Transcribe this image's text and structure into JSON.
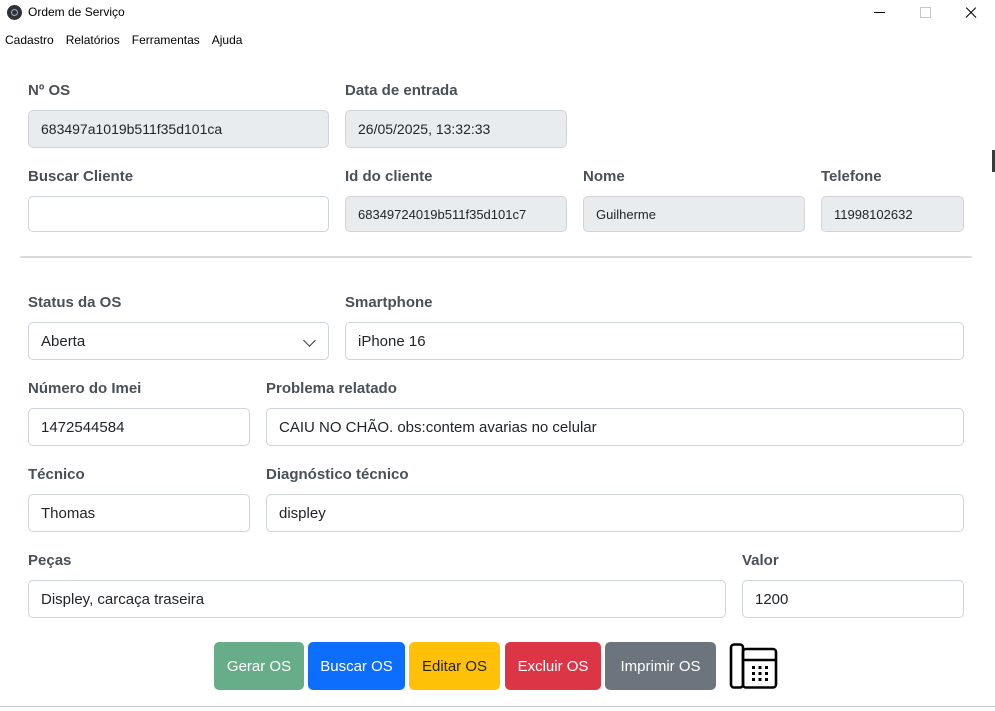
{
  "window": {
    "title": "Ordem de Serviço"
  },
  "menu": [
    "Cadastro",
    "Relatórios",
    "Ferramentas",
    "Ajuda"
  ],
  "form": {
    "os_number": {
      "label": "Nº OS",
      "value": "683497a1019b511f35d101ca"
    },
    "entry_date": {
      "label": "Data de entrada",
      "value": "26/05/2025, 13:32:33"
    },
    "search_client": {
      "label": "Buscar Cliente",
      "value": ""
    },
    "client_id": {
      "label": "Id do cliente",
      "value": "68349724019b511f35d101c7"
    },
    "client_name": {
      "label": "Nome",
      "value": "Guilherme"
    },
    "client_phone": {
      "label": "Telefone",
      "value": "11998102632"
    },
    "status": {
      "label": "Status da OS",
      "value": "Aberta"
    },
    "smartphone": {
      "label": "Smartphone",
      "value": "iPhone 16"
    },
    "imei": {
      "label": "Número do Imei",
      "value": "1472544584"
    },
    "problem": {
      "label": "Problema relatado",
      "value": "CAIU NO CHÃO. obs:contem avarias no celular"
    },
    "technician": {
      "label": "Técnico",
      "value": "Thomas"
    },
    "diagnosis": {
      "label": "Diagnóstico técnico",
      "value": "displey"
    },
    "parts": {
      "label": "Peças",
      "value": "Displey, carcaça traseira"
    },
    "price": {
      "label": "Valor",
      "value": "1200"
    }
  },
  "buttons": {
    "create": "Gerar OS",
    "search": "Buscar OS",
    "edit": "Editar OS",
    "delete": "Excluir OS",
    "print": "Imprimir OS"
  },
  "icons": {
    "app": "electron-icon",
    "calculator": "calculator-icon"
  }
}
